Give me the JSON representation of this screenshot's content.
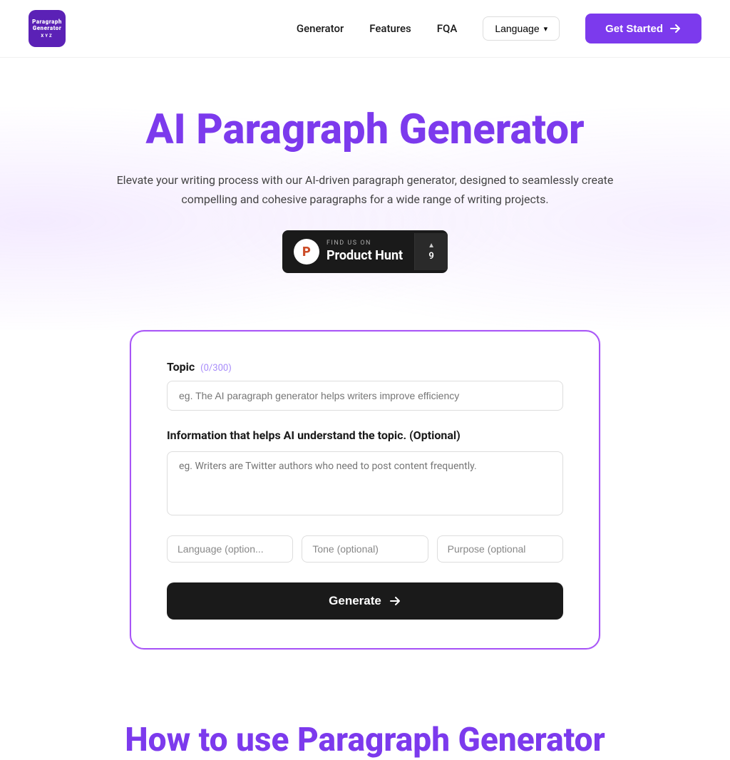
{
  "nav": {
    "logo_line1": "Paragraph",
    "logo_line2": "Generator",
    "logo_line3": "XYZ",
    "links": [
      {
        "label": "Generator",
        "href": "#"
      },
      {
        "label": "Features",
        "href": "#"
      },
      {
        "label": "FQA",
        "href": "#"
      }
    ],
    "language_label": "Language",
    "get_started_label": "Get Started"
  },
  "hero": {
    "title": "AI Paragraph Generator",
    "subtitle": "Elevate your writing process with our AI-driven paragraph generator, designed to seamlessly create compelling and cohesive paragraphs for a wide range of writing projects.",
    "product_hunt": {
      "find_us": "FIND US ON",
      "name": "Product Hunt",
      "score": "9",
      "icon_letter": "P"
    }
  },
  "form": {
    "topic_label": "Topic",
    "char_count": "(0/300)",
    "topic_placeholder": "eg. The AI paragraph generator helps writers improve efficiency",
    "info_label": "Information that helps AI understand the topic. (Optional)",
    "info_placeholder": "eg. Writers are Twitter authors who need to post content frequently.",
    "language_placeholder": "Language (option...",
    "tone_placeholder": "Tone (optional)",
    "purpose_placeholder": "Purpose (optional",
    "generate_label": "Generate"
  },
  "how_to": {
    "title": "How to use Paragraph Generator"
  }
}
